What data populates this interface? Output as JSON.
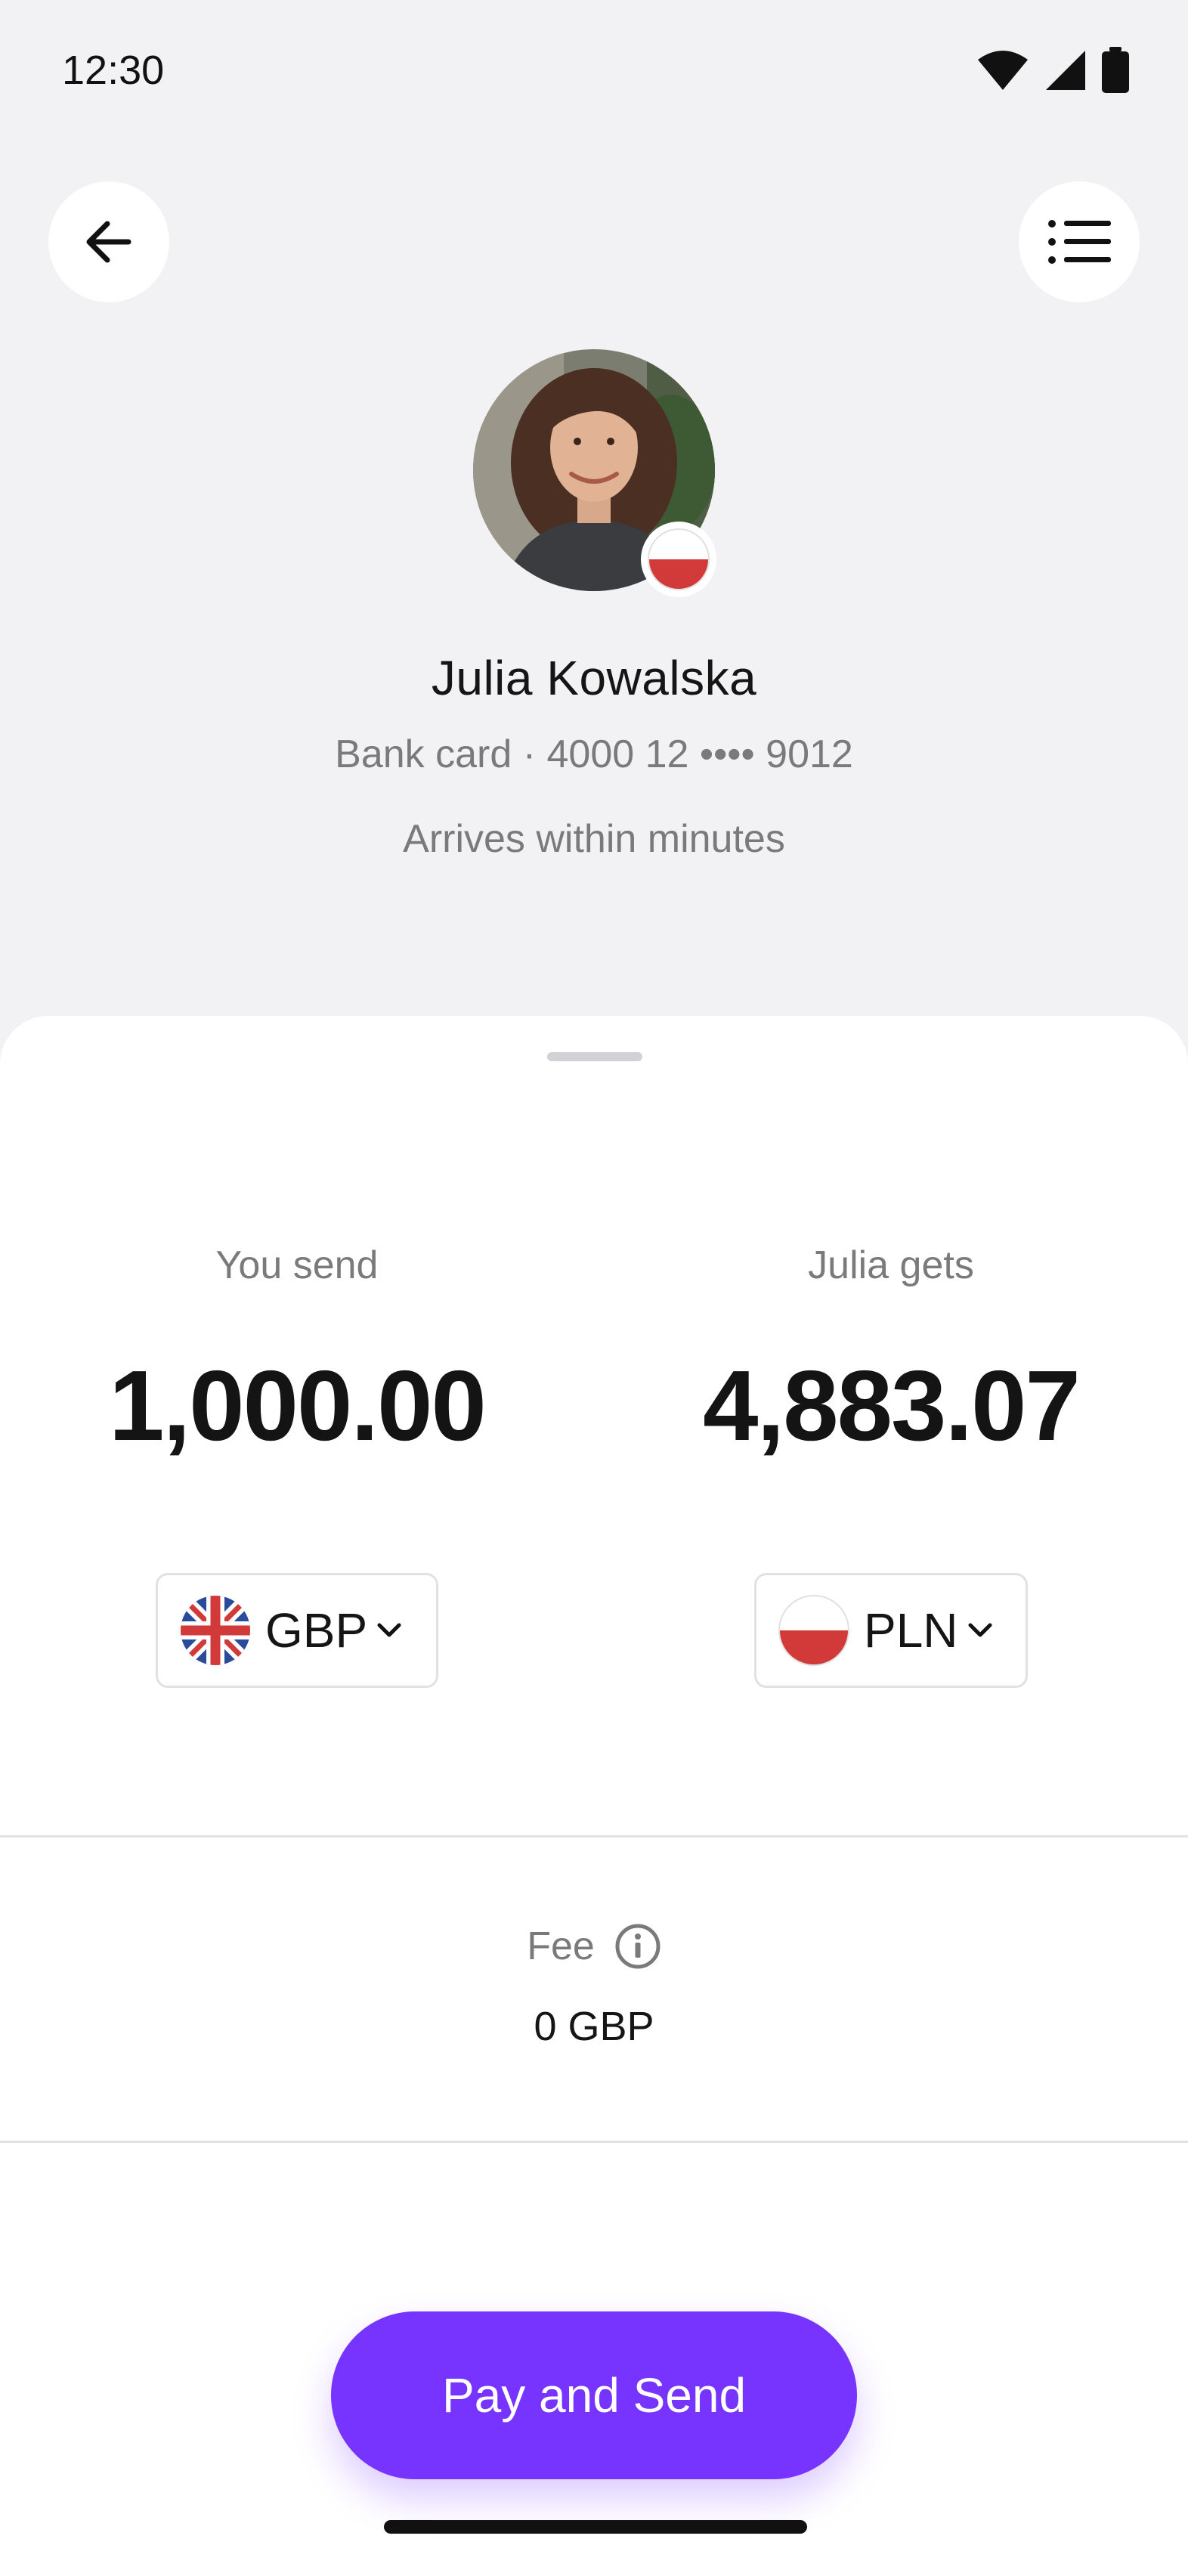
{
  "status_bar": {
    "time": "12:30"
  },
  "recipient": {
    "name": "Julia Kowalska",
    "card": "Bank card · 4000 12 •••• 9012",
    "eta": "Arrives within minutes",
    "flag_icon": "poland-flag-icon"
  },
  "send": {
    "label": "You send",
    "amount": "1,000.00",
    "currency": "GBP",
    "flag_icon": "uk-flag-icon"
  },
  "receive": {
    "label": "Julia gets",
    "amount": "4,883.07",
    "currency": "PLN",
    "flag_icon": "poland-flag-icon"
  },
  "fee": {
    "label": "Fee",
    "value": "0 GBP"
  },
  "actions": {
    "pay_label": "Pay and Send"
  },
  "colors": {
    "accent": "#7733FF",
    "background": "#F2F2F4",
    "sheet": "#FFFFFF",
    "poland_red": "#D23A3A"
  }
}
